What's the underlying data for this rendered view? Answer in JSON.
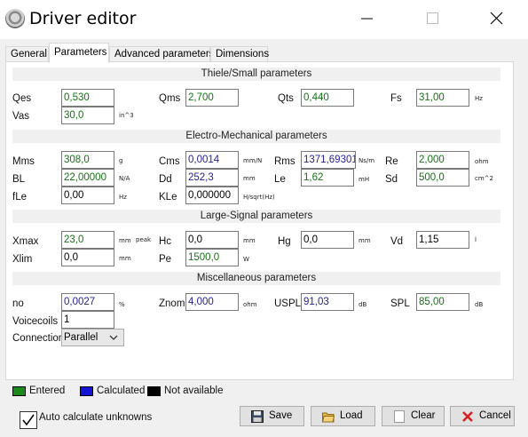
{
  "window": {
    "title": "Driver editor"
  },
  "tabs": [
    {
      "label": "General"
    },
    {
      "label": "Parameters"
    },
    {
      "label": "Advanced parameters"
    },
    {
      "label": "Dimensions"
    }
  ],
  "sections": {
    "ts": "Thiele/Small parameters",
    "em": "Electro-Mechanical parameters",
    "ls": "Large-Signal parameters",
    "misc": "Miscellaneous parameters"
  },
  "ts": {
    "qes": {
      "label": "Qes",
      "value": "0,530"
    },
    "qms": {
      "label": "Qms",
      "value": "2,700"
    },
    "qts": {
      "label": "Qts",
      "value": "0,440"
    },
    "fs": {
      "label": "Fs",
      "value": "31,00",
      "unit": "Hz"
    },
    "vas": {
      "label": "Vas",
      "value": "30,0",
      "unit": "in^3"
    }
  },
  "em": {
    "mms": {
      "label": "Mms",
      "value": "308,0",
      "unit": "g"
    },
    "cms": {
      "label": "Cms",
      "value": "0,0014",
      "unit": "mm/N"
    },
    "rms": {
      "label": "Rms",
      "value": "1371,69301",
      "unit": "Ns/m"
    },
    "re": {
      "label": "Re",
      "value": "2,000",
      "unit": "ohm"
    },
    "bl": {
      "label": "BL",
      "value": "22,00000",
      "unit": "N/A"
    },
    "dd": {
      "label": "Dd",
      "value": "252,3",
      "unit": "mm"
    },
    "le": {
      "label": "Le",
      "value": "1,62",
      "unit": "mH"
    },
    "sd": {
      "label": "Sd",
      "value": "500,0",
      "unit": "cm^2"
    },
    "fle": {
      "label": "fLe",
      "value": "0,00",
      "unit": "Hz"
    },
    "kle": {
      "label": "KLe",
      "value": "0,000000",
      "unit": "H/sqrt(Hz)"
    }
  },
  "ls": {
    "xmax": {
      "label": "Xmax",
      "value": "23,0",
      "unit": "mm",
      "unit2": "peak"
    },
    "hc": {
      "label": "Hc",
      "value": "0,0",
      "unit": "mm"
    },
    "hg": {
      "label": "Hg",
      "value": "0,0",
      "unit": "mm"
    },
    "vd": {
      "label": "Vd",
      "value": "1,15",
      "unit": "l"
    },
    "xlim": {
      "label": "Xlim",
      "value": "0,0",
      "unit": "mm"
    },
    "pe": {
      "label": "Pe",
      "value": "1500,0",
      "unit": "W"
    }
  },
  "misc": {
    "no": {
      "label": "no",
      "value": "0,0027",
      "unit": "%"
    },
    "znom": {
      "label": "Znom",
      "value": "4,000",
      "unit": "ohm"
    },
    "uspl": {
      "label": "USPL",
      "value": "91,03",
      "unit": "dB"
    },
    "spl": {
      "label": "SPL",
      "value": "85,00",
      "unit": "dB"
    },
    "voicecoils": {
      "label": "Voicecoils",
      "value": "1"
    },
    "connection": {
      "label": "Connection",
      "value": "Parallel"
    }
  },
  "legend": {
    "entered": {
      "label": "Entered",
      "color": "#1a8a1a"
    },
    "calculated": {
      "label": "Calculated",
      "color": "#1414d4"
    },
    "na": {
      "label": "Not available",
      "color": "#000000"
    }
  },
  "auto_calc": {
    "label": "Auto calculate unknowns",
    "checked": true
  },
  "buttons": {
    "save": "Save",
    "load": "Load",
    "clear": "Clear",
    "cancel": "Cancel"
  },
  "colors": {
    "entered_text": "#137313",
    "calculated_text": "#1f1f9a"
  }
}
